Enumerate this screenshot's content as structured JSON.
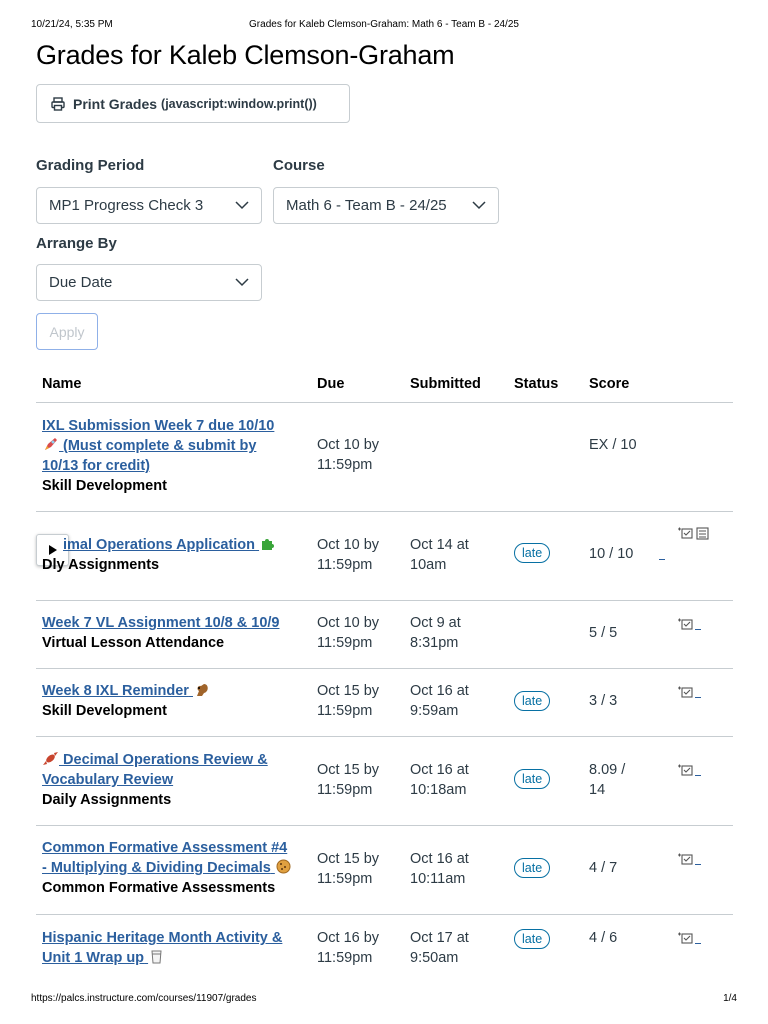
{
  "print_header": {
    "timestamp": "10/21/24, 5:35 PM",
    "title": "Grades for Kaleb Clemson-Graham: Math 6 - Team B - 24/25"
  },
  "page_title": "Grades for Kaleb Clemson-Graham",
  "print_button": {
    "label": "Print Grades",
    "aux": "(javascript:window.print())",
    "icon": "printer-icon"
  },
  "filters": {
    "grading_period": {
      "label": "Grading Period",
      "value": "MP1 Progress Check 3"
    },
    "course": {
      "label": "Course",
      "value": "Math 6 - Team B - 24/25"
    },
    "arrange_by": {
      "label": "Arrange By",
      "value": "Due Date"
    },
    "apply_label": "Apply"
  },
  "table": {
    "headers": {
      "name": "Name",
      "due": "Due",
      "submitted": "Submitted",
      "status": "Status",
      "score": "Score"
    },
    "rows": [
      {
        "title_a": "IXL Submission Week 7 due 10/10",
        "title_b": " (Must complete & submit by",
        "title_c": "10/13 for credit)",
        "emoji": "rocket-icon",
        "category": "Skill Development",
        "due_a": "Oct 10 by",
        "due_b": "11:59pm",
        "sub_a": "",
        "sub_b": "",
        "status": "",
        "score_a": "EX / 10",
        "score_b": ""
      },
      {
        "title_a": "imal Operations Application",
        "title_b": "",
        "title_c": "",
        "emoji": "puzzle-icon",
        "category": "ly Assignments",
        "category_prefix": "D",
        "due_a": "Oct 10 by",
        "due_b": "11:59pm",
        "sub_a": "Oct 14 at",
        "sub_b": "10am",
        "status": "late",
        "score_a": "10 / 10",
        "score_b": ""
      },
      {
        "title_a": "Week 7 VL Assignment 10/8 & 10/9",
        "title_b": "",
        "title_c": "",
        "emoji": "",
        "category": "Virtual Lesson Attendance",
        "due_a": "Oct 10 by",
        "due_b": "11:59pm",
        "sub_a": "Oct 9 at",
        "sub_b": "8:31pm",
        "status": "",
        "score_a": "5 / 5",
        "score_b": ""
      },
      {
        "title_a": "Week 8 IXL Reminder",
        "title_b": "",
        "title_c": "",
        "emoji": "squirrel-icon",
        "category": "Skill Development",
        "due_a": "Oct 15 by",
        "due_b": "11:59pm",
        "sub_a": "Oct 16 at",
        "sub_b": "9:59am",
        "status": "late",
        "score_a": "3 / 3",
        "score_b": ""
      },
      {
        "title_a": " Decimal Operations Review &",
        "title_b": "Vocabulary Review",
        "title_c": "",
        "emoji": "candy-icon",
        "category": "Daily Assignments",
        "due_a": "Oct 15 by",
        "due_b": "11:59pm",
        "sub_a": "Oct 16 at",
        "sub_b": "10:18am",
        "status": "late",
        "score_a": "8.09 /",
        "score_b": "14"
      },
      {
        "title_a": "Common Formative Assessment #4",
        "title_b": "- Multiplying & Dividing Decimals",
        "title_c": "",
        "emoji": "cookie-icon",
        "category": "Common Formative Assessments",
        "due_a": "Oct 15 by",
        "due_b": "11:59pm",
        "sub_a": "Oct 16 at",
        "sub_b": "10:11am",
        "status": "late",
        "score_a": "4 / 7",
        "score_b": ""
      },
      {
        "title_a": "Hispanic Heritage Month Activity &",
        "title_b": "Unit 1 Wrap up",
        "title_c": "",
        "emoji": "cup-icon",
        "category": "",
        "due_a": "Oct 16 by",
        "due_b": "11:59pm",
        "sub_a": "Oct 17 at",
        "sub_b": "9:50am",
        "status": "late",
        "score_a": "4 / 6",
        "score_b": ""
      }
    ]
  },
  "print_footer": {
    "url": "https://palcs.instructure.com/courses/11907/grades",
    "page": "1/4"
  },
  "colors": {
    "link": "#2b5f9e",
    "late_badge": "#0770a3",
    "border": "#c7cdd1"
  }
}
